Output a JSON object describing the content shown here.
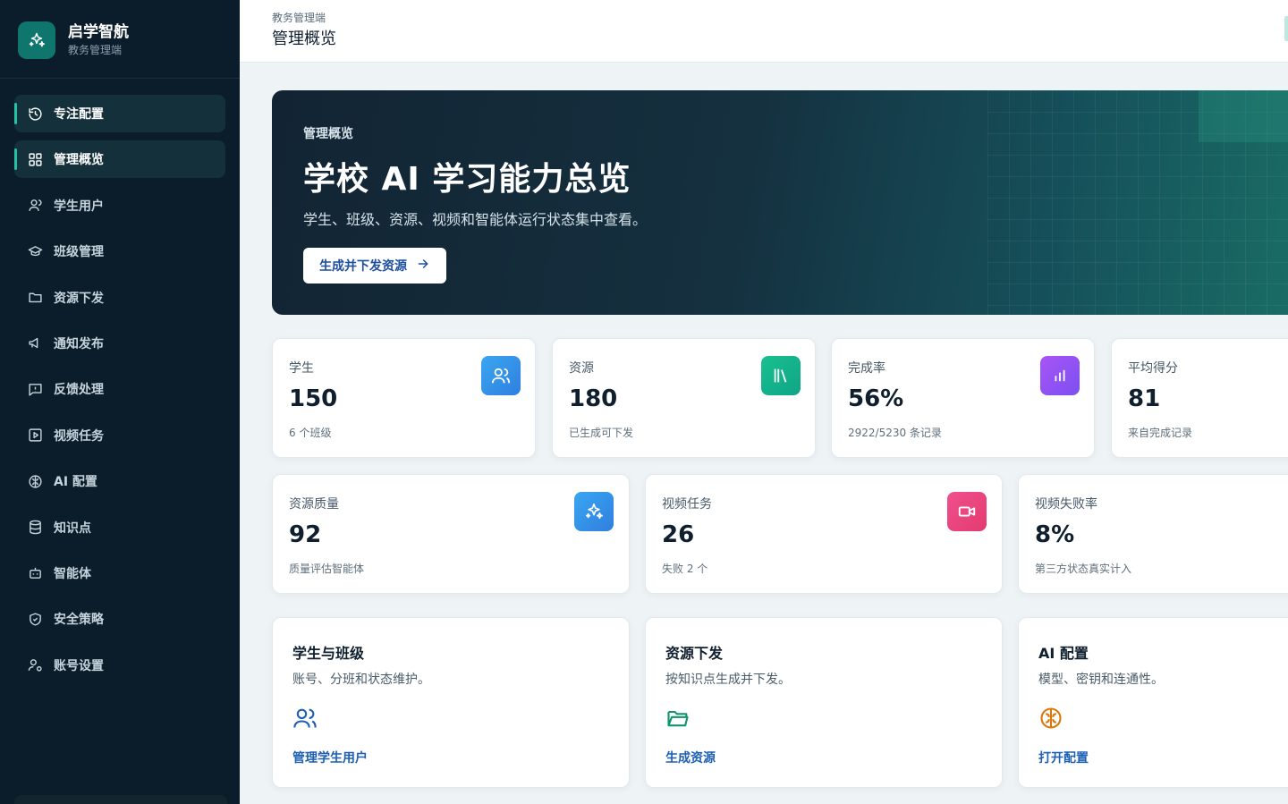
{
  "sidebar": {
    "brand_title": "启学智航",
    "brand_sub": "教务管理端",
    "items": [
      {
        "label": "专注配置",
        "icon": "focus-timer-icon",
        "active": true
      },
      {
        "label": "管理概览",
        "icon": "dashboard-grid-icon",
        "active": true
      },
      {
        "label": "学生用户",
        "icon": "user-icon",
        "active": false
      },
      {
        "label": "班级管理",
        "icon": "graduation-cap-icon",
        "active": false
      },
      {
        "label": "资源下发",
        "icon": "folder-icon",
        "active": false
      },
      {
        "label": "通知发布",
        "icon": "megaphone-icon",
        "active": false
      },
      {
        "label": "反馈处理",
        "icon": "message-alert-icon",
        "active": false
      },
      {
        "label": "视频任务",
        "icon": "video-play-icon",
        "active": false
      },
      {
        "label": "AI 配置",
        "icon": "brain-icon",
        "active": false
      },
      {
        "label": "知识点",
        "icon": "database-icon",
        "active": false
      },
      {
        "label": "智能体",
        "icon": "bot-icon",
        "active": false
      },
      {
        "label": "安全策略",
        "icon": "shield-check-icon",
        "active": false
      },
      {
        "label": "账号设置",
        "icon": "user-cog-icon",
        "active": false
      }
    ]
  },
  "header": {
    "breadcrumb": "教务管理端",
    "title": "管理概览"
  },
  "hero": {
    "eyebrow": "管理概览",
    "title": "学校 AI 学习能力总览",
    "desc": "学生、班级、资源、视频和智能体运行状态集中查看。",
    "button": "生成并下发资源"
  },
  "stats_row1": [
    {
      "label": "学生",
      "value": "150",
      "sub": "6 个班级",
      "icon": "users-icon",
      "color": "#2f8fe8"
    },
    {
      "label": "资源",
      "value": "180",
      "sub": "已生成可下发",
      "icon": "library-icon",
      "color": "#16b58f"
    },
    {
      "label": "完成率",
      "value": "56%",
      "sub": "2922/5230 条记录",
      "icon": "bar-chart-icon",
      "color": "#8b5cf6"
    },
    {
      "label": "平均得分",
      "value": "81",
      "sub": "来自完成记录",
      "icon": "",
      "color": ""
    }
  ],
  "stats_row2": [
    {
      "label": "资源质量",
      "value": "92",
      "sub": "质量评估智能体",
      "icon": "sparkles-icon",
      "color": "#2f8fe8"
    },
    {
      "label": "视频任务",
      "value": "26",
      "sub": "失败 2 个",
      "icon": "video-camera-icon",
      "color": "#ec4879"
    },
    {
      "label": "视频失败率",
      "value": "8%",
      "sub": "第三方状态真实计入",
      "icon": "",
      "color": ""
    }
  ],
  "features": [
    {
      "title": "学生与班级",
      "desc": "账号、分班和状态维护。",
      "icon": "users-icon",
      "color": "#1d5fb3",
      "link": "管理学生用户"
    },
    {
      "title": "资源下发",
      "desc": "按知识点生成并下发。",
      "icon": "folder-open-icon",
      "color": "#12936f",
      "link": "生成资源"
    },
    {
      "title": "AI 配置",
      "desc": "模型、密钥和连通性。",
      "icon": "brain-icon",
      "color": "#d9770a",
      "link": "打开配置"
    }
  ]
}
